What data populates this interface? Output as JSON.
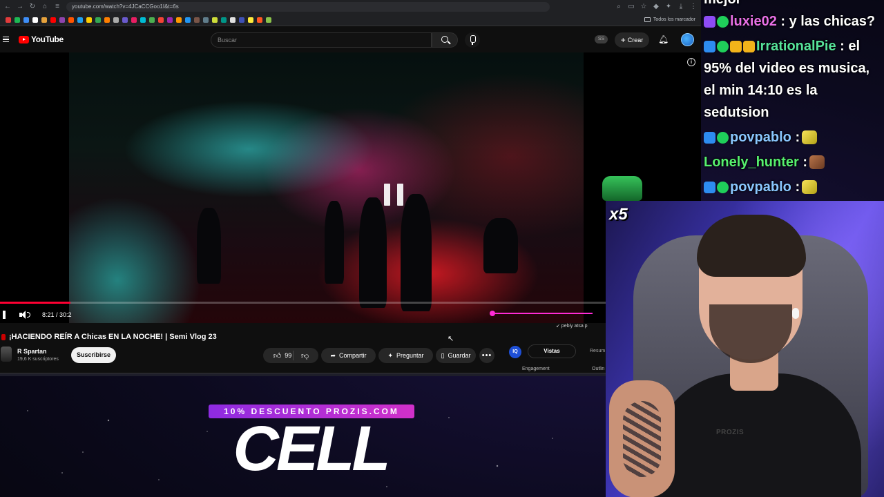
{
  "browser": {
    "url": "youtube.com/watch?v=4JCaCCGoo1I&t=6s",
    "bookmarks_all": "Todos los marcador",
    "bookmark_colors": [
      "#e33b3b",
      "#1db954",
      "#3e8ef7",
      "#ffffff",
      "#e6a23c",
      "#ff0000",
      "#8e44ad",
      "#ff5500",
      "#1da1f2",
      "#ffcc00",
      "#34a853",
      "#ff7f00",
      "#aaaaaa",
      "#6a5acd",
      "#e91e63",
      "#00bcd4",
      "#4caf50",
      "#f44336",
      "#9c27b0",
      "#ff9800",
      "#2196f3",
      "#795548",
      "#607d8b",
      "#cddc39",
      "#009688",
      "#e0e0e0",
      "#3f51b5",
      "#ffeb3b",
      "#ff5722",
      "#8bc34a"
    ]
  },
  "youtube": {
    "logo": "YouTube",
    "search_placeholder": "Buscar",
    "ss_badge": "SS",
    "create_label": "Crear"
  },
  "player": {
    "time": "8:21 / 30:2",
    "progress_fraction": 0.1,
    "mini_caption": "↙ pebiy atsa p"
  },
  "video": {
    "title": "¡HACIENDO REÍR A Chicas EN LA NOCHE! | Semi Vlog 23",
    "channel": "R Spartan",
    "subscribers": "19,6 K suscriptores",
    "subscribe_label": "Suscribirse",
    "likes": "99",
    "share_label": "Compartir",
    "ask_label": "Preguntar",
    "save_label": "Guardar"
  },
  "side_panel": {
    "iq": "IQ",
    "tab_active": "Vistas",
    "tab_other": "Resum",
    "label_left": "Engagement",
    "label_right": "Outlin"
  },
  "chat": [
    {
      "user": "",
      "message": "mejor",
      "user_color": "#ffffff",
      "badges": []
    },
    {
      "user": "luxie02",
      "message": " : y las chicas?",
      "user_color": "#e870e6",
      "badges": [
        "purple",
        "green"
      ]
    },
    {
      "user": "IrrationalPie",
      "message": " : el",
      "user_color": "#56e39a",
      "badges": [
        "cube",
        "green",
        "gold",
        "gold"
      ]
    },
    {
      "user": "",
      "message": "95% del video es musica,",
      "user_color": "#ffffff",
      "badges": []
    },
    {
      "user": "",
      "message": "el min 14:10 es la",
      "user_color": "#ffffff",
      "badges": []
    },
    {
      "user": "",
      "message": "sedutsion",
      "user_color": "#ffffff",
      "badges": []
    },
    {
      "user": "povpablo",
      "message": " :",
      "user_color": "#8ac7ff",
      "badges": [
        "cube",
        "green"
      ],
      "emote": "banana"
    },
    {
      "user": "Lonely_hunter",
      "message": " :",
      "user_color": "#56f06e",
      "badges": [],
      "emote": "face"
    },
    {
      "user": "povpablo",
      "message": " :",
      "user_color": "#8ac7ff",
      "badges": [
        "cube",
        "green"
      ],
      "emote": "banana"
    }
  ],
  "gift": {
    "count": "x5"
  },
  "cam": {
    "shirt_brand": "PROZIS"
  },
  "ad": {
    "banner": "10% DESCUENTO PROZIS.COM",
    "word": "CELL"
  }
}
